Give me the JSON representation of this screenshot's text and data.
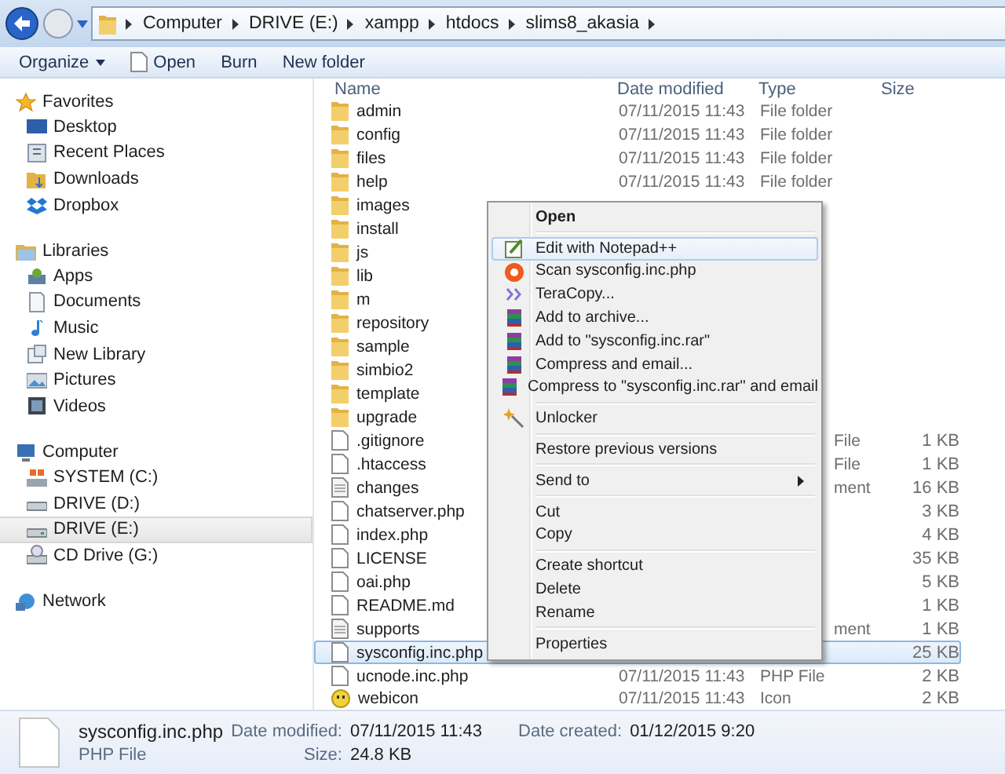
{
  "address_bar": {
    "crumbs": [
      "Computer",
      "DRIVE (E:)",
      "xampp",
      "htdocs",
      "slims8_akasia"
    ]
  },
  "toolbar": [
    {
      "label": "Organize",
      "dropdown": true
    },
    {
      "label": "Open",
      "dropdown": false
    },
    {
      "label": "Burn",
      "dropdown": false
    },
    {
      "label": "New folder",
      "dropdown": false
    }
  ],
  "sidebar": [
    {
      "title": "Favorites",
      "items": [
        {
          "label": "Desktop",
          "selected": false
        },
        {
          "label": "Recent Places",
          "selected": false
        },
        {
          "label": "Downloads",
          "selected": false
        },
        {
          "label": "Dropbox",
          "selected": false
        }
      ]
    },
    {
      "title": "Libraries",
      "items": [
        {
          "label": "Apps",
          "selected": false
        },
        {
          "label": "Documents",
          "selected": false
        },
        {
          "label": "Music",
          "selected": false
        },
        {
          "label": "New Library",
          "selected": false
        },
        {
          "label": "Pictures",
          "selected": false
        },
        {
          "label": "Videos",
          "selected": false
        }
      ]
    },
    {
      "title": "Computer",
      "items": [
        {
          "label": "SYSTEM (C:)",
          "selected": false
        },
        {
          "label": "DRIVE (D:)",
          "selected": false
        },
        {
          "label": "DRIVE (E:)",
          "selected": true
        },
        {
          "label": "CD Drive (G:)",
          "selected": false
        }
      ]
    },
    {
      "title": "Network"
    }
  ],
  "columns": [
    "Name",
    "Date modified",
    "Type",
    "Size"
  ],
  "files": [
    {
      "kind": "folder",
      "name": "admin",
      "date": "07/11/2015 11:43",
      "type": "File folder",
      "selected": false
    },
    {
      "kind": "folder",
      "name": "config",
      "date": "07/11/2015 11:43",
      "type": "File folder",
      "selected": false
    },
    {
      "kind": "folder",
      "name": "files",
      "date": "07/11/2015 11:43",
      "type": "File folder",
      "selected": false
    },
    {
      "kind": "folder",
      "name": "help",
      "date": "07/11/2015 11:43",
      "type": "File folder",
      "selected": false
    },
    {
      "kind": "folder",
      "name": "images",
      "selected": false
    },
    {
      "kind": "folder",
      "name": "install",
      "selected": false
    },
    {
      "kind": "folder",
      "name": "js",
      "selected": false
    },
    {
      "kind": "folder",
      "name": "lib",
      "selected": false
    },
    {
      "kind": "folder",
      "name": "m",
      "selected": false
    },
    {
      "kind": "folder",
      "name": "repository",
      "selected": false
    },
    {
      "kind": "folder",
      "name": "sample",
      "selected": false
    },
    {
      "kind": "folder",
      "name": "simbio2",
      "selected": false
    },
    {
      "kind": "folder",
      "name": "template",
      "selected": false
    },
    {
      "kind": "folder",
      "name": "upgrade",
      "selected": false
    },
    {
      "kind": "file",
      "name": ".gitignore",
      "type": "File",
      "size": "1 KB",
      "selected": false
    },
    {
      "kind": "file",
      "name": ".htaccess",
      "type": "File",
      "size": "1 KB",
      "selected": false
    },
    {
      "kind": "text",
      "name": "changes",
      "type": "ment",
      "size": "16 KB",
      "selected": false
    },
    {
      "kind": "file",
      "name": "chatserver.php",
      "size": "3 KB",
      "selected": false
    },
    {
      "kind": "file",
      "name": "index.php",
      "size": "4 KB",
      "selected": false
    },
    {
      "kind": "file",
      "name": "LICENSE",
      "size": "35 KB",
      "selected": false
    },
    {
      "kind": "file",
      "name": "oai.php",
      "size": "5 KB",
      "selected": false
    },
    {
      "kind": "file",
      "name": "README.md",
      "size": "1 KB",
      "selected": false
    },
    {
      "kind": "text",
      "name": "supports",
      "type": "ment",
      "size": "1 KB",
      "selected": false
    },
    {
      "kind": "file",
      "name": "sysconfig.inc.php",
      "size": "25 KB",
      "selected": true
    },
    {
      "kind": "file",
      "name": "ucnode.inc.php",
      "date": "07/11/2015 11:43",
      "type": "PHP File",
      "size": "2 KB",
      "selected": false
    },
    {
      "kind": "smiley",
      "name": "webicon",
      "date": "07/11/2015 11:43",
      "type": "Icon",
      "size": "2 KB",
      "selected": false
    }
  ],
  "context_menu": [
    [
      {
        "label": "Open",
        "default": true,
        "selected": false,
        "submenu": false
      }
    ],
    [
      {
        "label": "Edit with Notepad++",
        "default": false,
        "selected": true,
        "submenu": false
      },
      {
        "label": "Scan sysconfig.inc.php",
        "default": false,
        "selected": false,
        "submenu": false
      },
      {
        "label": "TeraCopy...",
        "default": false,
        "selected": false,
        "submenu": false
      },
      {
        "label": "Add to archive...",
        "default": false,
        "selected": false,
        "submenu": false
      },
      {
        "label": "Add to \"sysconfig.inc.rar\"",
        "default": false,
        "selected": false,
        "submenu": false
      },
      {
        "label": "Compress and email...",
        "default": false,
        "selected": false,
        "submenu": false
      },
      {
        "label": "Compress to \"sysconfig.inc.rar\" and email",
        "default": false,
        "selected": false,
        "submenu": false
      }
    ],
    [
      {
        "label": "Unlocker",
        "default": false,
        "selected": false,
        "submenu": false
      }
    ],
    [
      {
        "label": "Restore previous versions",
        "default": false,
        "selected": false,
        "submenu": false
      }
    ],
    [
      {
        "label": "Send to",
        "default": false,
        "selected": false,
        "submenu": true
      }
    ],
    [
      {
        "label": "Cut",
        "default": false,
        "selected": false,
        "submenu": false
      },
      {
        "label": "Copy",
        "default": false,
        "selected": false,
        "submenu": false
      }
    ],
    [
      {
        "label": "Create shortcut",
        "default": false,
        "selected": false,
        "submenu": false
      },
      {
        "label": "Delete",
        "default": false,
        "selected": false,
        "submenu": false
      },
      {
        "label": "Rename",
        "default": false,
        "selected": false,
        "submenu": false
      }
    ],
    [
      {
        "label": "Properties",
        "default": false,
        "selected": false,
        "submenu": false
      }
    ]
  ],
  "details_pane": {
    "name": "sysconfig.inc.php",
    "type": "PHP File",
    "fields": [
      {
        "label": "Date modified:",
        "value": "07/11/2015 11:43"
      },
      {
        "label": "Date created:",
        "value": "01/12/2015 9:20"
      },
      {
        "label": "Size:",
        "value": "24.8 KB"
      }
    ]
  }
}
